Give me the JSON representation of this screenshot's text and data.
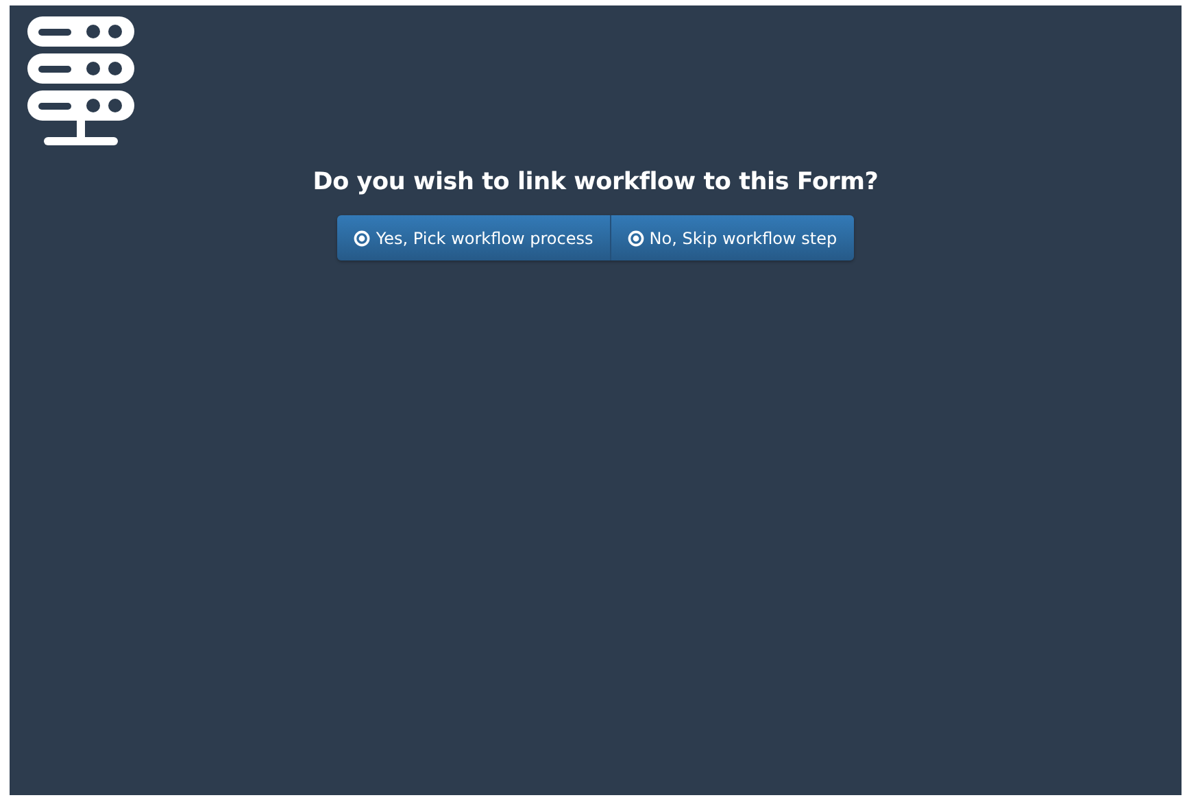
{
  "heading": "Do you wish to link workflow to this Form?",
  "buttons": [
    {
      "label": "Yes, Pick workflow process"
    },
    {
      "label": "No, Skip workflow step"
    }
  ]
}
